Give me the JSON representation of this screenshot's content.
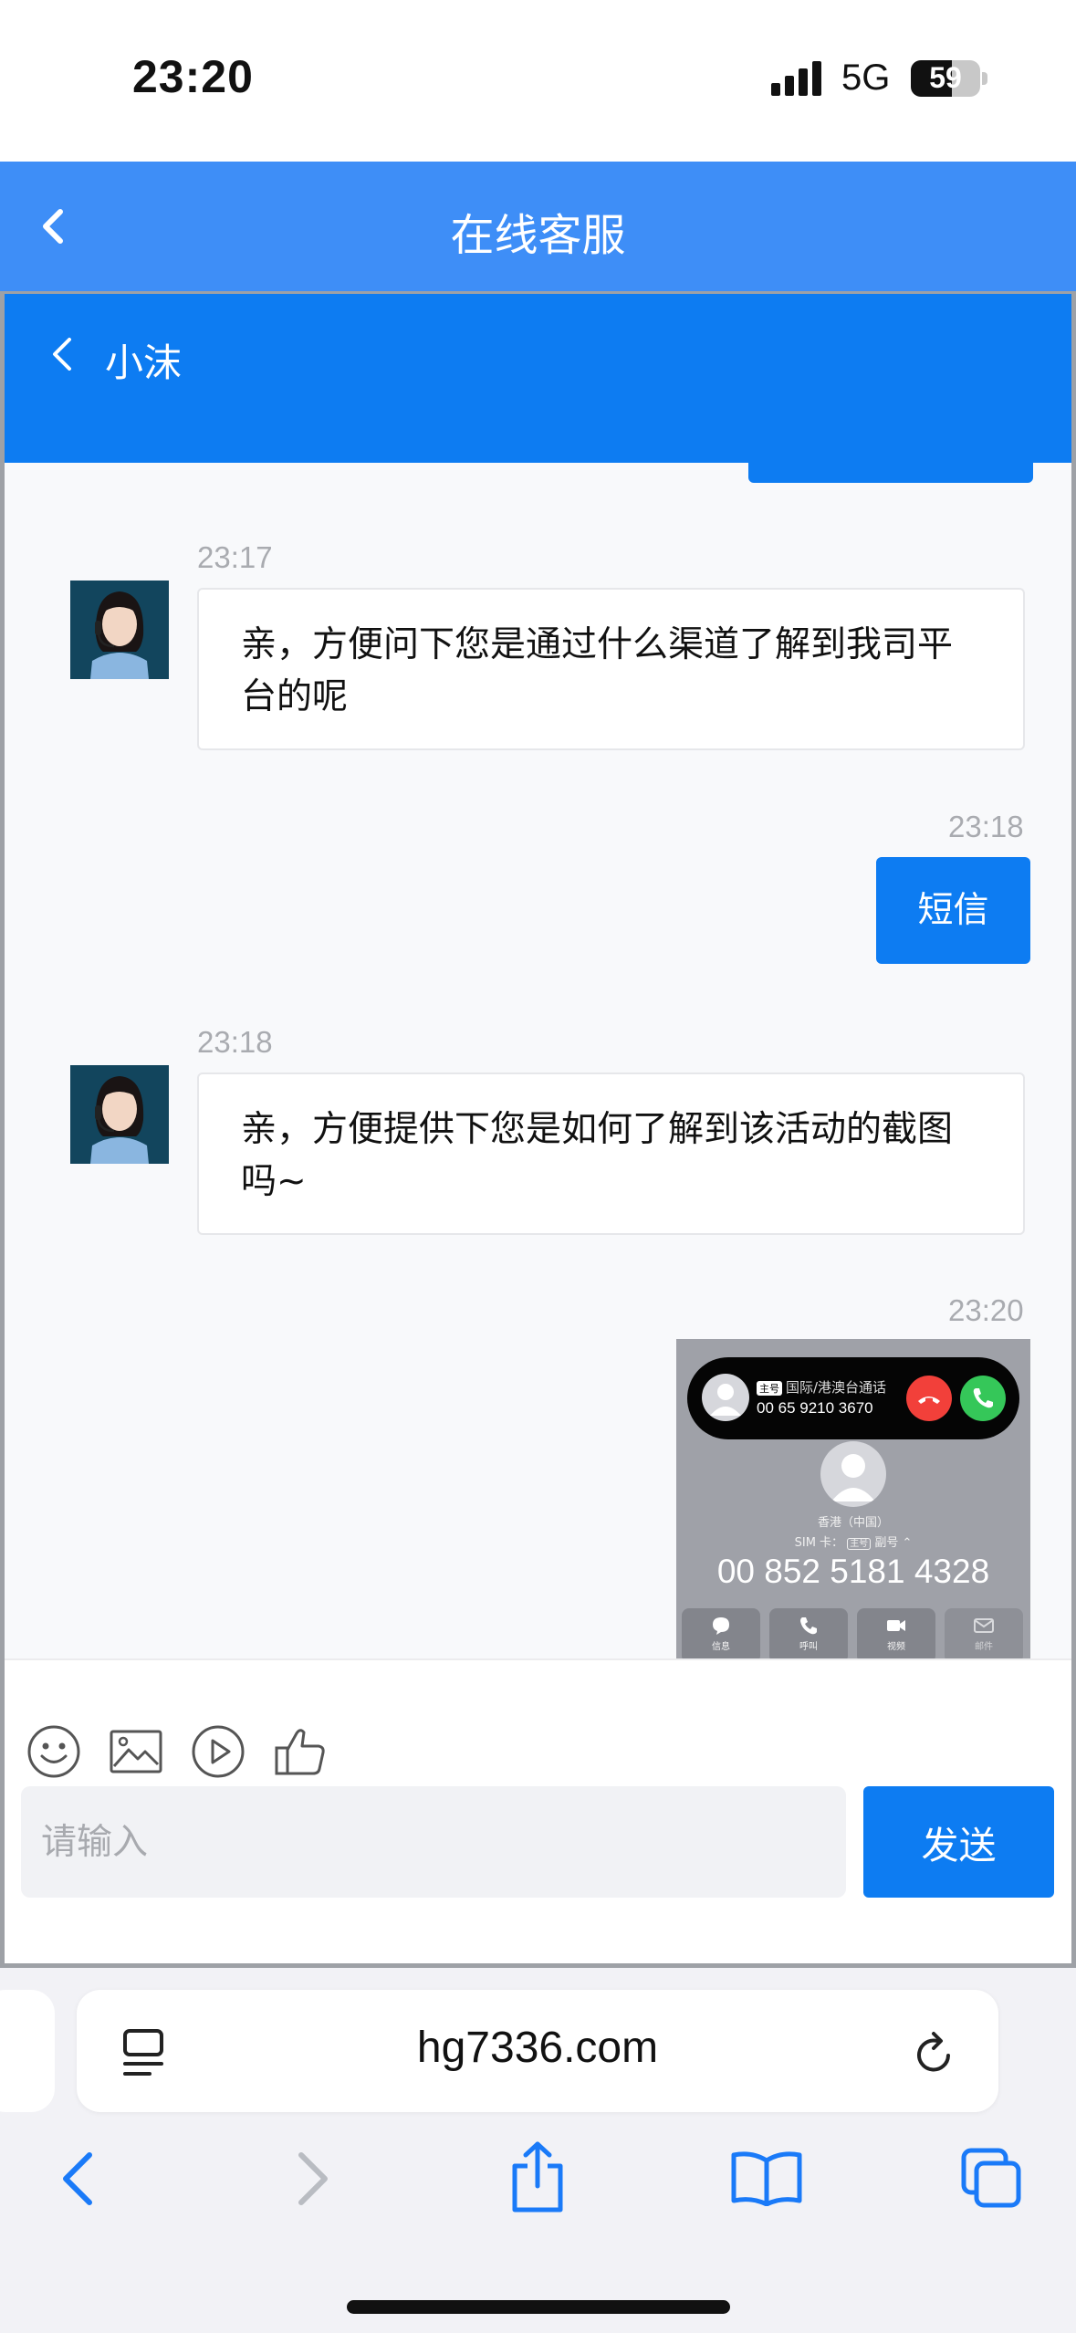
{
  "status_bar": {
    "time": "23:20",
    "network": "5G",
    "battery": "59",
    "battery_level": 0.59
  },
  "header": {
    "title": "在线客服"
  },
  "chat": {
    "agent_name": "小沫",
    "messages": [
      {
        "side": "agent",
        "time": "23:17",
        "text": "亲，方便问下您是通过什么渠道了解到我司平台的呢"
      },
      {
        "side": "user",
        "time": "23:18",
        "text": "短信"
      },
      {
        "side": "agent",
        "time": "23:18",
        "text": "亲，方便提供下您是如何了解到该活动的截图吗~"
      },
      {
        "side": "user",
        "time": "23:20",
        "type": "image"
      }
    ],
    "screenshot": {
      "call_tag": "主号",
      "call_type": "国际/港澳台通话",
      "caller_number": "00 65 9210 3670",
      "region": "香港（中国）",
      "sim": "SIM 卡：",
      "sim_tag": "主号",
      "sim_secondary": "副号",
      "number": "00 852 5181 4328",
      "actions": [
        "信息",
        "呼叫",
        "视频",
        "邮件"
      ]
    }
  },
  "composer": {
    "placeholder": "请输入",
    "send_label": "发送"
  },
  "browser": {
    "url": "hg7336.com"
  },
  "colors": {
    "header": "#3e8ef7",
    "brand": "#0d7cf2"
  }
}
